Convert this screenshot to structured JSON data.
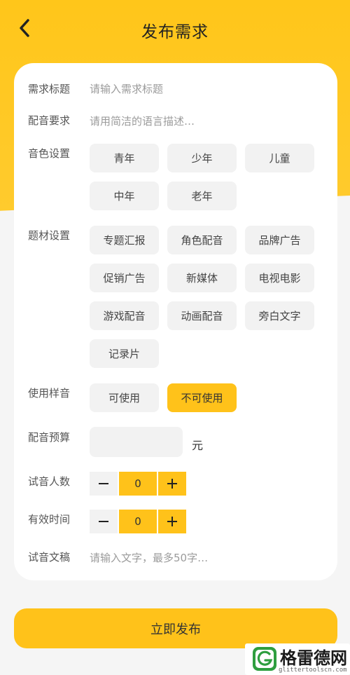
{
  "header": {
    "title": "发布需求"
  },
  "form": {
    "title_label": "需求标题",
    "title_placeholder": "请输入需求标题",
    "requirement_label": "配音要求",
    "requirement_placeholder": "请用简洁的语言描述…",
    "voice_label": "音色设置",
    "voice_options": [
      "青年",
      "少年",
      "儿童",
      "中年",
      "老年"
    ],
    "topic_label": "题材设置",
    "topic_options": [
      "专题汇报",
      "角色配音",
      "品牌广告",
      "促销广告",
      "新媒体",
      "电视电影",
      "游戏配音",
      "动画配音",
      "旁白文字",
      "记录片"
    ],
    "sample_label": "使用样音",
    "sample_options": [
      "可使用",
      "不可使用"
    ],
    "sample_selected": "不可使用",
    "budget_label": "配音预算",
    "budget_value": "",
    "budget_unit": "元",
    "audition_label": "试音人数",
    "audition_value": "0",
    "validity_label": "有效时间",
    "validity_value": "0",
    "script_label": "试音文稿",
    "script_placeholder": "请输入文字，最多50字…"
  },
  "submit_label": "立即发布",
  "watermark": {
    "name": "格雷德网",
    "url": "glittertoolscn.com"
  },
  "colors": {
    "accent": "#ffc21a",
    "option_bg": "#f2f2f2",
    "card": "#ffffff"
  }
}
